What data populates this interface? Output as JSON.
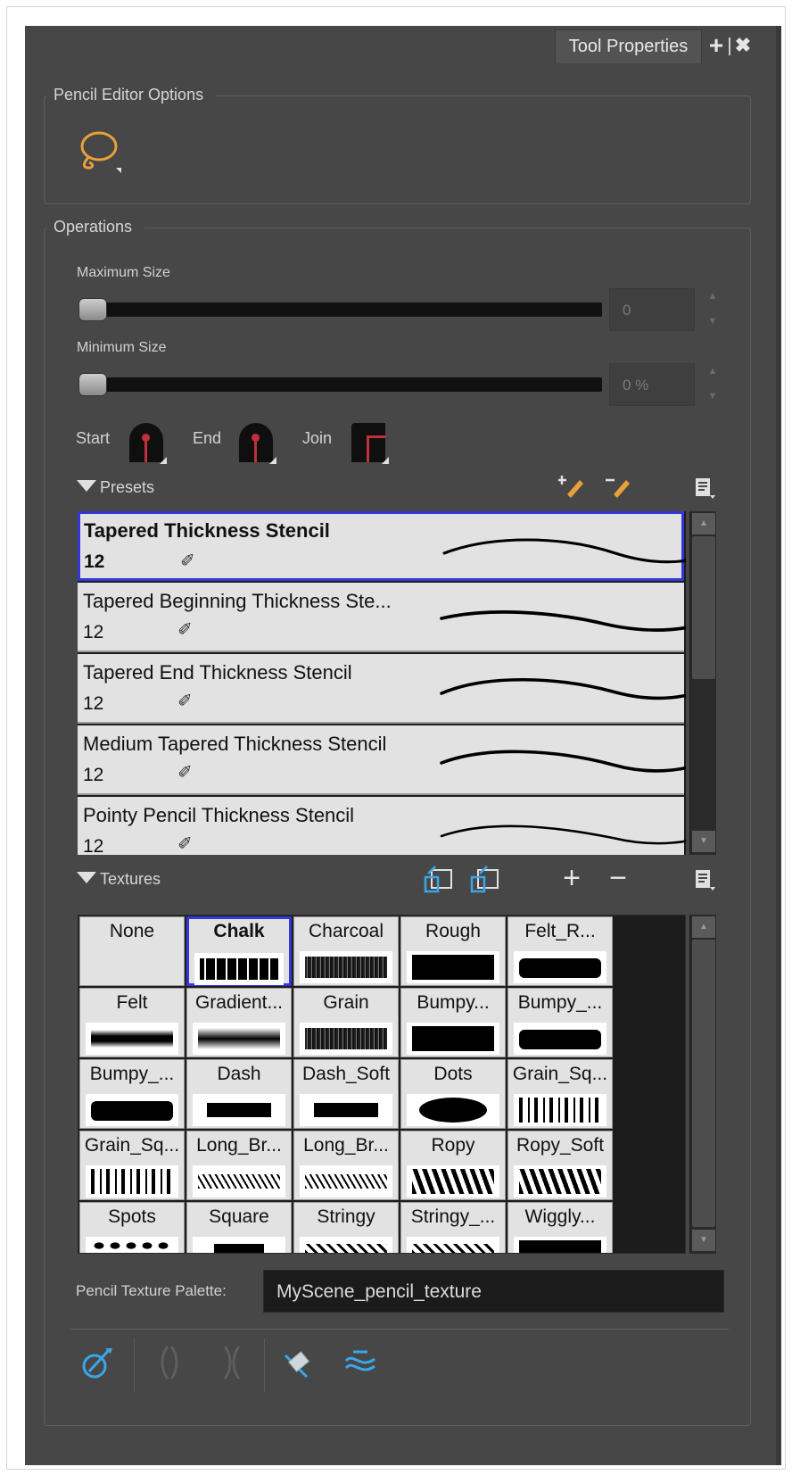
{
  "window": {
    "tab_label": "Tool Properties",
    "add_button": "+",
    "close_button": "✖"
  },
  "editor_options": {
    "title": "Pencil Editor Options"
  },
  "operations": {
    "title": "Operations",
    "max_size": {
      "label": "Maximum Size",
      "value": "0"
    },
    "min_size": {
      "label": "Minimum Size",
      "value": "0 %"
    },
    "start_label": "Start",
    "end_label": "End",
    "join_label": "Join"
  },
  "presets": {
    "label": "Presets",
    "items": [
      {
        "name": "Tapered Thickness Stencil",
        "size": "12",
        "selected": true
      },
      {
        "name": "Tapered Beginning Thickness Ste...",
        "size": "12",
        "selected": false
      },
      {
        "name": "Tapered End Thickness Stencil",
        "size": "12",
        "selected": false
      },
      {
        "name": "Medium Tapered Thickness Stencil",
        "size": "12",
        "selected": false
      },
      {
        "name": "Pointy Pencil Thickness Stencil",
        "size": "12",
        "selected": false
      }
    ]
  },
  "textures": {
    "label": "Textures",
    "add_symbol": "+",
    "remove_symbol": "−",
    "items": [
      {
        "name": "None",
        "pattern": "none"
      },
      {
        "name": "Chalk",
        "pattern": "chalk",
        "selected": true
      },
      {
        "name": "Charcoal",
        "pattern": "noise"
      },
      {
        "name": "Rough",
        "pattern": "solid"
      },
      {
        "name": "Felt_R...",
        "pattern": "wave"
      },
      {
        "name": "Felt",
        "pattern": "blur"
      },
      {
        "name": "Gradient...",
        "pattern": "gradient"
      },
      {
        "name": "Grain",
        "pattern": "noise"
      },
      {
        "name": "Bumpy...",
        "pattern": "solid"
      },
      {
        "name": "Bumpy_...",
        "pattern": "wave"
      },
      {
        "name": "Bumpy_...",
        "pattern": "wave"
      },
      {
        "name": "Dash",
        "pattern": "dash"
      },
      {
        "name": "Dash_Soft",
        "pattern": "dash"
      },
      {
        "name": "Dots",
        "pattern": "dot"
      },
      {
        "name": "Grain_Sq...",
        "pattern": "bars"
      },
      {
        "name": "Grain_Sq...",
        "pattern": "bars"
      },
      {
        "name": "Long_Br...",
        "pattern": "scribble"
      },
      {
        "name": "Long_Br...",
        "pattern": "scribble"
      },
      {
        "name": "Ropy",
        "pattern": "ropy"
      },
      {
        "name": "Ropy_Soft",
        "pattern": "ropy"
      },
      {
        "name": "Spots",
        "pattern": "spots"
      },
      {
        "name": "Square",
        "pattern": "square"
      },
      {
        "name": "Stringy",
        "pattern": "stringy"
      },
      {
        "name": "Stringy_...",
        "pattern": "stringy"
      },
      {
        "name": "Wiggly...",
        "pattern": "solid"
      }
    ]
  },
  "palette": {
    "label": "Pencil Texture Palette:",
    "value": "MyScene_pencil_texture"
  },
  "colors": {
    "panel_bg": "#474747",
    "selection": "#3436d8",
    "accent_orange": "#e8a03a",
    "accent_blue": "#3aa6e8"
  }
}
